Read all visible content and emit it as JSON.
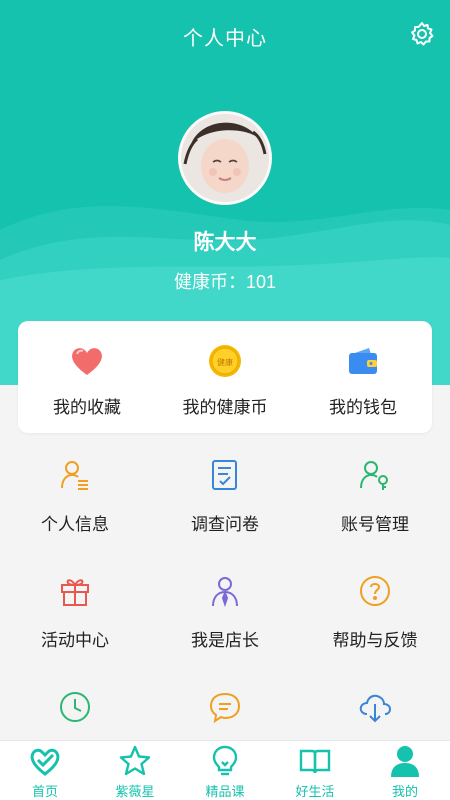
{
  "header": {
    "title": "个人中心",
    "settings_icon": "gear-icon"
  },
  "profile": {
    "name": "陈大大",
    "coins": "健康币：101"
  },
  "quick_actions": [
    {
      "label": "我的收藏",
      "icon": "heart-icon"
    },
    {
      "label": "我的健康币",
      "icon": "coin-icon",
      "coin_text": "健康"
    },
    {
      "label": "我的钱包",
      "icon": "wallet-icon"
    }
  ],
  "menu": [
    {
      "label": "个人信息",
      "icon": "user-info-icon"
    },
    {
      "label": "调查问卷",
      "icon": "survey-icon"
    },
    {
      "label": "账号管理",
      "icon": "account-key-icon"
    },
    {
      "label": "活动中心",
      "icon": "gift-icon"
    },
    {
      "label": "我是店长",
      "icon": "manager-icon"
    },
    {
      "label": "帮助与反馈",
      "icon": "help-icon"
    },
    {
      "label": "",
      "icon": "clock-icon"
    },
    {
      "label": "",
      "icon": "chat-icon"
    },
    {
      "label": "",
      "icon": "cloud-download-icon"
    }
  ],
  "tabs": [
    {
      "label": "首页",
      "icon": "home-heart-icon"
    },
    {
      "label": "紫薇星",
      "icon": "star-icon"
    },
    {
      "label": "精品课",
      "icon": "bulb-icon"
    },
    {
      "label": "好生活",
      "icon": "book-icon"
    },
    {
      "label": "我的",
      "icon": "person-icon",
      "active": true
    }
  ],
  "colors": {
    "primary": "#15c2ad",
    "background": "#f4f4f4",
    "card": "#ffffff"
  }
}
